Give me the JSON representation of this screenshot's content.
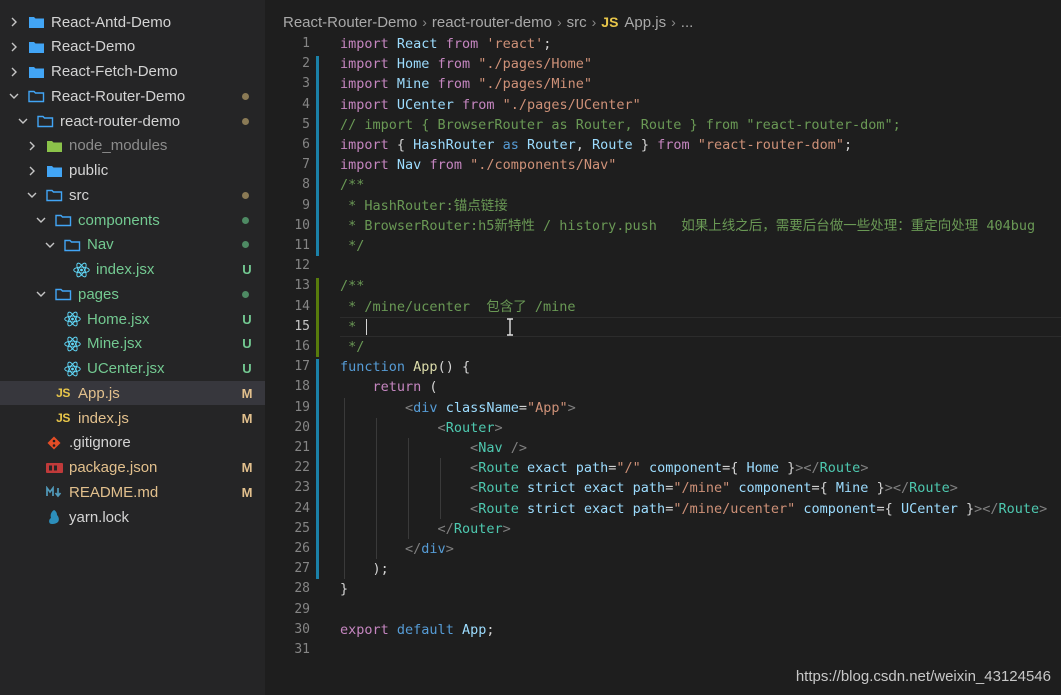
{
  "sidebar": {
    "items": [
      {
        "name": "React-Antd-Demo",
        "kind": "folder",
        "expanded": false,
        "badge": ""
      },
      {
        "name": "React-Demo",
        "kind": "folder",
        "expanded": false,
        "badge": ""
      },
      {
        "name": "React-Fetch-Demo",
        "kind": "folder",
        "expanded": false,
        "badge": ""
      },
      {
        "name": "React-Router-Demo",
        "kind": "folder",
        "expanded": true,
        "badge": "dot"
      },
      {
        "name": "react-router-demo",
        "kind": "folder",
        "expanded": true,
        "badge": "dot"
      },
      {
        "name": "node_modules",
        "kind": "folder",
        "expanded": false,
        "badge": ""
      },
      {
        "name": "public",
        "kind": "folder",
        "expanded": false,
        "badge": ""
      },
      {
        "name": "src",
        "kind": "folder",
        "expanded": true,
        "badge": "dot"
      },
      {
        "name": "components",
        "kind": "folder",
        "expanded": true,
        "badge": "dot"
      },
      {
        "name": "Nav",
        "kind": "folder",
        "expanded": true,
        "badge": "dot"
      },
      {
        "name": "index.jsx",
        "kind": "react",
        "badge": "U"
      },
      {
        "name": "pages",
        "kind": "folder",
        "expanded": true,
        "badge": "dot"
      },
      {
        "name": "Home.jsx",
        "kind": "react",
        "badge": "U"
      },
      {
        "name": "Mine.jsx",
        "kind": "react",
        "badge": "U"
      },
      {
        "name": "UCenter.jsx",
        "kind": "react",
        "badge": "U"
      },
      {
        "name": "App.js",
        "kind": "js",
        "badge": "M",
        "active": true
      },
      {
        "name": "index.js",
        "kind": "js",
        "badge": "M"
      },
      {
        "name": ".gitignore",
        "kind": "git",
        "badge": ""
      },
      {
        "name": "package.json",
        "kind": "npm",
        "badge": "M"
      },
      {
        "name": "README.md",
        "kind": "md",
        "badge": "M"
      },
      {
        "name": "yarn.lock",
        "kind": "yarn",
        "badge": ""
      }
    ]
  },
  "breadcrumb": {
    "parts": [
      "React-Router-Demo",
      "react-router-demo",
      "src"
    ],
    "file_lang": "JS",
    "file": "App.js",
    "tail": "..."
  },
  "editor": {
    "current_line": 15,
    "lines": [
      {
        "n": "1",
        "text": "import React from 'react';"
      },
      {
        "n": "2",
        "text": "import Home from \"./pages/Home\""
      },
      {
        "n": "3",
        "text": "import Mine from \"./pages/Mine\""
      },
      {
        "n": "4",
        "text": "import UCenter from \"./pages/UCenter\""
      },
      {
        "n": "5",
        "text": "// import { BrowserRouter as Router, Route } from \"react-router-dom\";"
      },
      {
        "n": "6",
        "text": "import { HashRouter as Router, Route } from \"react-router-dom\";"
      },
      {
        "n": "7",
        "text": "import Nav from \"./components/Nav\""
      },
      {
        "n": "8",
        "text": "/**"
      },
      {
        "n": "9",
        "text": " * HashRouter:锚点链接"
      },
      {
        "n": "10",
        "text": " * BrowserRouter:h5新特性 / history.push   如果上线之后，需要后台做一些处理：重定向处理 404bug"
      },
      {
        "n": "11",
        "text": " */"
      },
      {
        "n": "12",
        "text": ""
      },
      {
        "n": "13",
        "text": "/**"
      },
      {
        "n": "14",
        "text": " * /mine/ucenter  包含了 /mine"
      },
      {
        "n": "15",
        "text": " * "
      },
      {
        "n": "16",
        "text": " */"
      },
      {
        "n": "17",
        "text": "function App() {"
      },
      {
        "n": "18",
        "text": "    return ("
      },
      {
        "n": "19",
        "text": "        <div className=\"App\">"
      },
      {
        "n": "20",
        "text": "            <Router>"
      },
      {
        "n": "21",
        "text": "                <Nav />"
      },
      {
        "n": "22",
        "text": "                <Route exact path=\"/\" component={ Home }></Route>"
      },
      {
        "n": "23",
        "text": "                <Route strict exact path=\"/mine\" component={ Mine }></Route>"
      },
      {
        "n": "24",
        "text": "                <Route strict exact path=\"/mine/ucenter\" component={ UCenter }></Route>"
      },
      {
        "n": "25",
        "text": "            </Router>"
      },
      {
        "n": "26",
        "text": "        </div>"
      },
      {
        "n": "27",
        "text": "    );"
      },
      {
        "n": "28",
        "text": "}"
      },
      {
        "n": "29",
        "text": ""
      },
      {
        "n": "30",
        "text": "export default App;"
      },
      {
        "n": "31",
        "text": ""
      }
    ]
  },
  "watermark": "https://blog.csdn.net/weixin_43124546",
  "colors": {
    "editor_bg": "#1e1e1e",
    "sidebar_bg": "#252526",
    "keyword": "#c586c0",
    "string": "#ce9178",
    "comment": "#6a9955",
    "variable": "#9cdcfe",
    "component": "#4ec9b0"
  }
}
